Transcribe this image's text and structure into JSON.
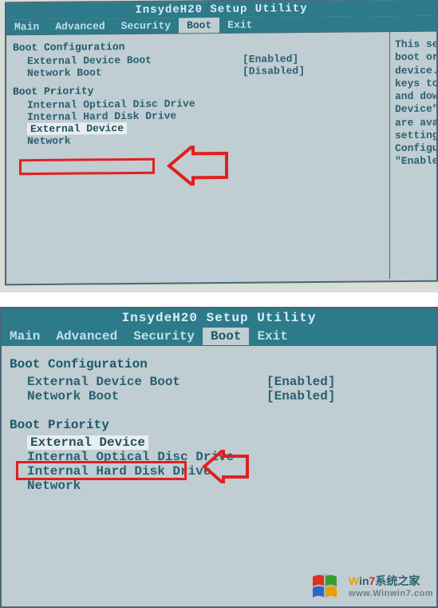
{
  "s1": {
    "title": "InsydeH20 Setup Utility",
    "menu": [
      "Main",
      "Advanced",
      "Security",
      "Boot",
      "Exit"
    ],
    "active_menu": "Boot",
    "config_heading": "Boot Configuration",
    "config_items": [
      {
        "label": "External Device Boot",
        "value": "[Enabled]"
      },
      {
        "label": "Network Boot",
        "value": "[Disabled]"
      }
    ],
    "priority_heading": "Boot Priority",
    "priority_items": [
      "Internal Optical Disc Drive",
      "Internal Hard Disk Drive",
      "External Device",
      "Network"
    ],
    "selected_index": 2,
    "help_lines": [
      "This sett",
      "boot orde",
      "device. U",
      "keys to m",
      "and down.",
      "Device\" a",
      "are avail",
      "setting i",
      "Configura",
      "\"Enabled\""
    ]
  },
  "s2": {
    "title": "InsydeH20 Setup Utility",
    "menu": [
      "Main",
      "Advanced",
      "Security",
      "Boot",
      "Exit"
    ],
    "active_menu": "Boot",
    "config_heading": "Boot Configuration",
    "config_items": [
      {
        "label": "External Device Boot",
        "value": "[Enabled]"
      },
      {
        "label": "Network Boot",
        "value": "[Enabled]"
      }
    ],
    "priority_heading": "Boot Priority",
    "priority_items": [
      "External Device",
      "Internal Optical Disc Drive",
      "Internal Hard Disk Drive",
      "Network"
    ],
    "selected_index": 0
  },
  "watermark": {
    "brand_prefix": "W",
    "brand_mid": "in",
    "brand_num": "7",
    "brand_suffix": "系统之家",
    "url": "www.Winwin7.com"
  }
}
